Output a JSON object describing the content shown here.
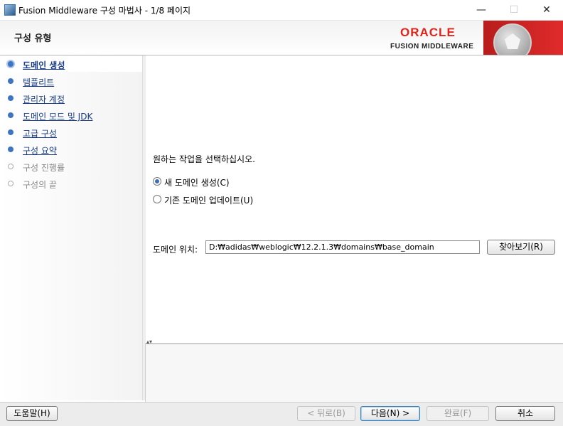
{
  "window": {
    "title": "Fusion Middleware 구성 마법사 - 1/8 페이지",
    "minimize": "—",
    "maximize": "☐",
    "close": "✕"
  },
  "header": {
    "page_title": "구성 유형",
    "logo_oracle": "ORACLE",
    "logo_fmw": "FUSION MIDDLEWARE",
    "brand_color": "#e2231a"
  },
  "steps": [
    {
      "label": "도메인 생성",
      "state": "current"
    },
    {
      "label": "템플리트",
      "state": "link"
    },
    {
      "label": "관리자 계정",
      "state": "link"
    },
    {
      "label": "도메인 모드 및 JDK",
      "state": "link"
    },
    {
      "label": "고급 구성",
      "state": "link"
    },
    {
      "label": "구성 요약",
      "state": "link"
    },
    {
      "label": "구성 진행률",
      "state": "disabled"
    },
    {
      "label": "구성의 끝",
      "state": "disabled"
    }
  ],
  "main": {
    "prompt": "원하는 작업을 선택하십시오.",
    "options": [
      {
        "label": "새 도메인 생성(C)",
        "selected": true
      },
      {
        "label": "기존 도메인 업데이트(U)",
        "selected": false
      }
    ],
    "location_label": "도메인 위치:",
    "location_value": "D:₩adidas₩weblogic₩12.2.1.3₩domains₩base_domain",
    "browse_button": "찾아보기(R)"
  },
  "footer": {
    "help": "도움말(H)",
    "back": "< 뒤로(B)",
    "next": "다음(N) >",
    "finish": "완료(F)",
    "cancel": "취소"
  }
}
